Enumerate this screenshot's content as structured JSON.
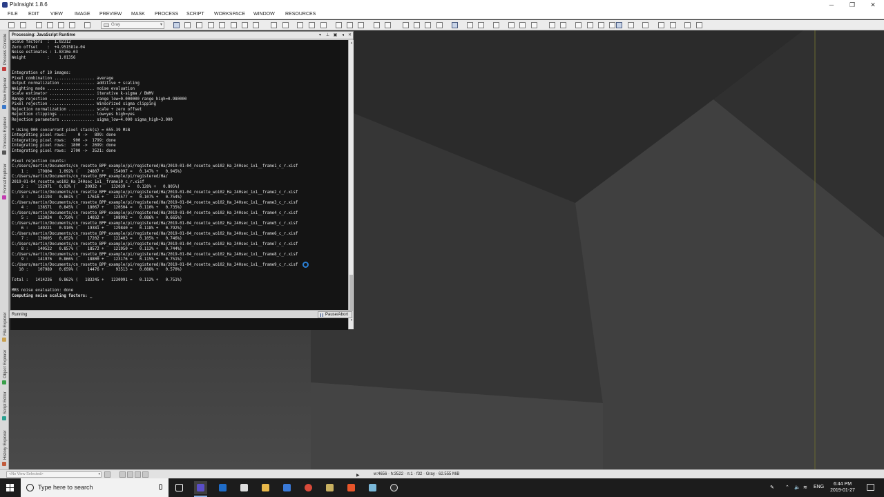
{
  "window": {
    "title": "PixInsight 1.8.6",
    "minimize": "─",
    "maximize": "❐",
    "close": "✕"
  },
  "menu": [
    "FILE",
    "EDIT",
    "VIEW",
    "IMAGE",
    "PREVIEW",
    "MASK",
    "PROCESS",
    "SCRIPT",
    "WORKSPACE",
    "WINDOW",
    "RESOURCES"
  ],
  "toolbar": {
    "color_space": "Gray"
  },
  "sidebar": {
    "tabs": [
      "Process Console",
      "View Explorer",
      "Process Explorer",
      "Format Explorer",
      "File Explorer",
      "Object Explorer",
      "Script Editor",
      "History Explorer"
    ]
  },
  "console": {
    "title": "Processing: JavaScript Runtime",
    "lines": [
      "Scale factors  :  1.02312",
      "Zero offset    :  +4.951581e-04",
      "Noise estimates : 1.8310e-03",
      "Weight         :    1.01356",
      "",
      "",
      "Integration of 10 images:",
      "Pixel combination ................. average",
      "Output normalization .............. additive + scaling",
      "Weighting mode .................... noise evaluation",
      "Scale estimator ................... iterative k-sigma / BWMV",
      "Range rejection ................... range_low=0.000000 range_high=0.980000",
      "Pixel rejection ................... Winsorized sigma clipping",
      "Rejection normalization ........... scale + zero offset",
      "Rejection clippings ............... low=yes high=yes",
      "Rejection parameters .............. sigma_low=4.000 sigma_high=3.000",
      "",
      "* Using 900 concurrent pixel stack(s) = 655.39 MiB",
      "Integrating pixel rows:     0 ->   899: done",
      "Integrating pixel rows:   900 ->  1799: done",
      "Integrating pixel rows:  1800 ->  2699: done",
      "Integrating pixel rows:  2700 ->  3521: done",
      "",
      "Pixel rejection counts:",
      "C:/Users/martin/Documents/cn_rosette_BPP_example/pi/registered/Ha/2019-01-04_rosette_wo102_Ha_240sec_1x1__frame1_c_r.xisf",
      "    1 :    179804   1.092% (    24807 +    154997 =   0.147% +   0.945%)",
      "C:/Users/martin/Documents/cn_rosette_BPP_example/pi/registered/Ha/",
      "2019-01-04_rosette_wo102_Ha_240sec_1x1__frame10_c_r.xisf",
      "    2 :    152971   0.93% (    20932 +    132039 =   0.128% +   0.805%)",
      "C:/Users/martin/Documents/cn_rosette_BPP_example/pi/registered/Ha/2019-01-04_rosette_wo102_Ha_240sec_1x1__frame2_c_r.xisf",
      "    3 :    141193   0.861% (    17616 +    123577 =   0.107% +   0.754%)",
      "C:/Users/martin/Documents/cn_rosette_BPP_example/pi/registered/Ha/2019-01-04_rosette_wo102_Ha_240sec_1x1__frame3_c_r.xisf",
      "    4 :    138571   0.845% (    18067 +    120504 =   0.110% +   0.735%)",
      "C:/Users/martin/Documents/cn_rosette_BPP_example/pi/registered/Ha/2019-01-04_rosette_wo102_Ha_240sec_1x1__frame4_c_r.xisf",
      "    5 :    123024   0.750% (    14032 +    108992 =   0.086% +   0.665%)",
      "C:/Users/martin/Documents/cn_rosette_BPP_example/pi/registered/Ha/2019-01-04_rosette_wo102_Ha_240sec_1x1__frame5_c_r.xisf",
      "    6 :    149221   0.910% (    19381 +    129840 =   0.118% +   0.792%)",
      "C:/Users/martin/Documents/cn_rosette_BPP_example/pi/registered/Ha/2019-01-04_rosette_wo102_Ha_240sec_1x1__frame6_c_r.xisf",
      "    7 :    139605   0.852% (    17202 +    122403 =   0.105% +   0.746%)",
      "C:/Users/martin/Documents/cn_rosette_BPP_example/pi/registered/Ha/2019-01-04_rosette_wo102_Ha_240sec_1x1__frame7_c_r.xisf",
      "    8 :    140522   0.857% (    18572 +    121950 =   0.113% +   0.744%)",
      "C:/Users/martin/Documents/cn_rosette_BPP_example/pi/registered/Ha/2019-01-04_rosette_wo102_Ha_240sec_1x1__frame8_c_r.xisf",
      "    9 :    141976   0.866% (    18800 +    123176 =   0.115% +   0.751%)",
      "C:/Users/martin/Documents/cn_rosette_BPP_example/pi/registered/Ha/2019-01-04_rosette_wo102_Ha_240sec_1x1__frame9_c_r.xisf",
      "   10 :    107989   0.659% (    14476 +     93513 =   0.088% +   0.570%)",
      "",
      "Total :   1414236   0.862% (   183245 +   1230991 =   0.112% +   0.751%)",
      "",
      "MRS noise evaluation: done",
      "Computing noise scaling factors: _"
    ],
    "bold_line_index": 49,
    "status": "Running",
    "pause_label": "Pause/Abort"
  },
  "statusbar": {
    "view_selector": "<No View Selected>",
    "image_info": "w:4656  ·  h:3522  ·  n:1  ·  f32  ·  Gray  ·  62.555 MiB"
  },
  "taskbar": {
    "search_placeholder": "Type here to search",
    "language": "ENG",
    "time": "6:44 PM",
    "date": "2019-01-27"
  },
  "colors": {
    "accent": "#2a7fd4",
    "console_bg": "#141414",
    "taskbar_bg": "#1c1c1c"
  }
}
